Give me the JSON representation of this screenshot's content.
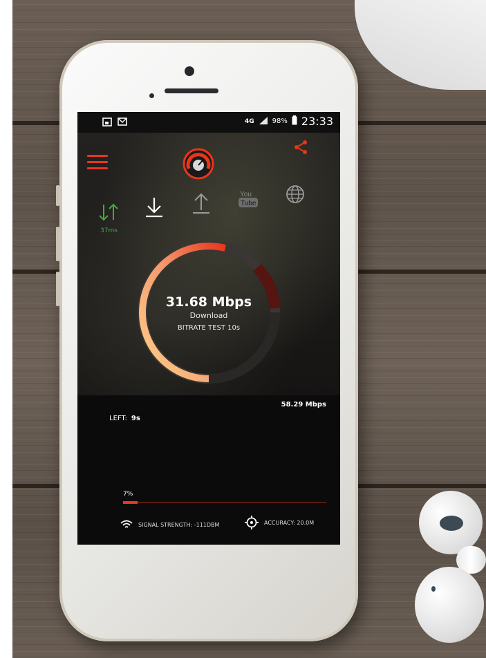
{
  "status_bar": {
    "network": "4G",
    "battery": "98%",
    "time": "23:33"
  },
  "tabs": [
    {
      "icon": "ping-arrows-icon",
      "label": "37ms",
      "color": "#3fae3f"
    },
    {
      "icon": "download-icon"
    },
    {
      "icon": "upload-icon"
    },
    {
      "icon": "youtube-icon",
      "label": "You Tube"
    },
    {
      "icon": "globe-icon"
    }
  ],
  "gauge": {
    "speed": "31.68 Mbps",
    "mode": "Download",
    "test_name": "BITRATE TEST 10s",
    "fill_fraction": 0.72
  },
  "graph": {
    "max_speed": "58.29 Mbps",
    "left_label": "LEFT:",
    "left_value": "9s"
  },
  "progress": {
    "label": "7%",
    "value": 0.07
  },
  "info": {
    "signal": "SIGNAL STRENGTH: -111DBM",
    "accuracy": "ACCURACY: 20.0M"
  },
  "colors": {
    "accent": "#e8361b",
    "ping_green": "#3fae3f"
  }
}
